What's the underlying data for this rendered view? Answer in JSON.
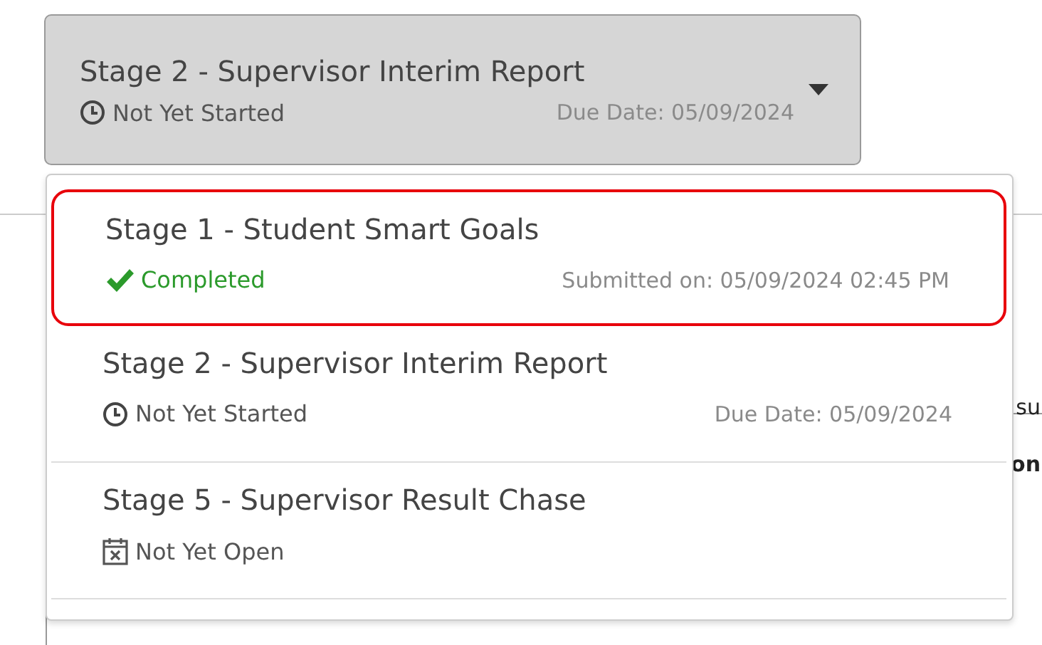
{
  "trigger": {
    "title": "Stage 2 - Supervisor Interim Report",
    "status": "Not Yet Started",
    "kind": "not_started",
    "date": "Due Date: 05/09/2024"
  },
  "menu": {
    "items": [
      {
        "title": "Stage 1 - Student Smart Goals",
        "status": "Completed",
        "kind": "completed",
        "date": "Submitted on: 05/09/2024 02:45 PM",
        "highlighted": true
      },
      {
        "title": "Stage 2 - Supervisor Interim Report",
        "status": "Not Yet Started",
        "kind": "not_started",
        "date": "Due Date: 05/09/2024",
        "highlighted": false
      },
      {
        "title": "Stage 5 - Supervisor Result Chase",
        "status": "Not Yet Open",
        "kind": "not_open",
        "highlighted": false
      }
    ]
  },
  "background": {
    "fragments": [
      "su",
      "on"
    ]
  }
}
